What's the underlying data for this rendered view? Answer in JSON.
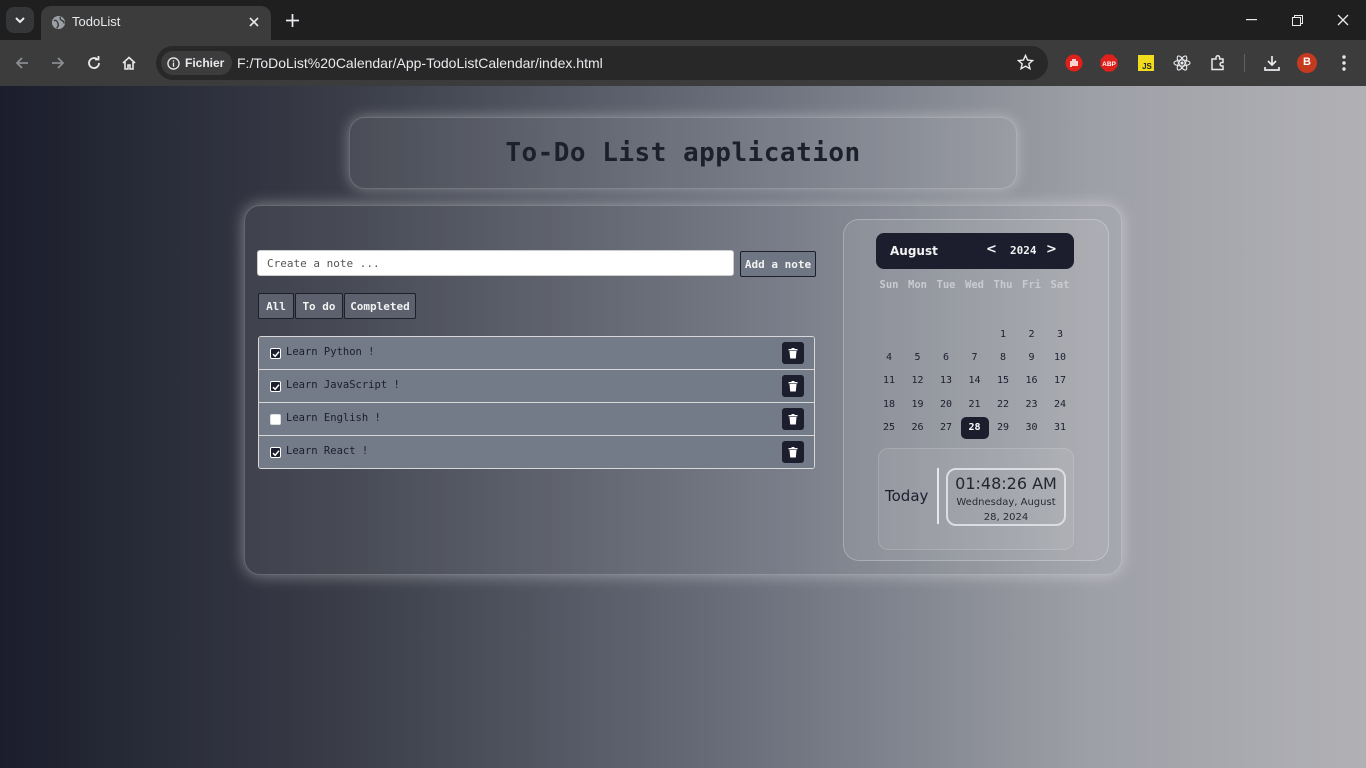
{
  "browser": {
    "tab_title": "TodoList",
    "security_label": "Fichier",
    "url": "F:/ToDoList%20Calendar/App-TodoListCalendar/index.html",
    "profile_initial": "B",
    "extensions": [
      "stop-hand-extension",
      "adblock-plus-extension",
      "js-extension",
      "react-devtools-extension",
      "puzzle-extensions"
    ]
  },
  "app": {
    "title": "To-Do List application",
    "input": {
      "placeholder": "Create a note ...",
      "value": ""
    },
    "add_button": "Add a note",
    "filters": [
      {
        "label": "All",
        "active": true
      },
      {
        "label": "To do",
        "active": false
      },
      {
        "label": "Completed",
        "active": false
      }
    ],
    "todos": [
      {
        "text": "Learn Python !",
        "done": true
      },
      {
        "text": "Learn JavaScript !",
        "done": true
      },
      {
        "text": "Learn English !",
        "done": false
      },
      {
        "text": "Learn React !",
        "done": true
      }
    ]
  },
  "calendar": {
    "month": "August",
    "year": "2024",
    "prev": "<",
    "next": ">",
    "weekdays": [
      "Sun",
      "Mon",
      "Tue",
      "Wed",
      "Thu",
      "Fri",
      "Sat"
    ],
    "first_weekday": 4,
    "days_in_month": 31,
    "today": 28
  },
  "clock": {
    "label": "Today",
    "time": "01:48:26 AM",
    "date": "Wednesday, August 28, 2024"
  },
  "colors": {
    "accent_dark": "#1c1e2e",
    "item_bg": "#737a88"
  }
}
